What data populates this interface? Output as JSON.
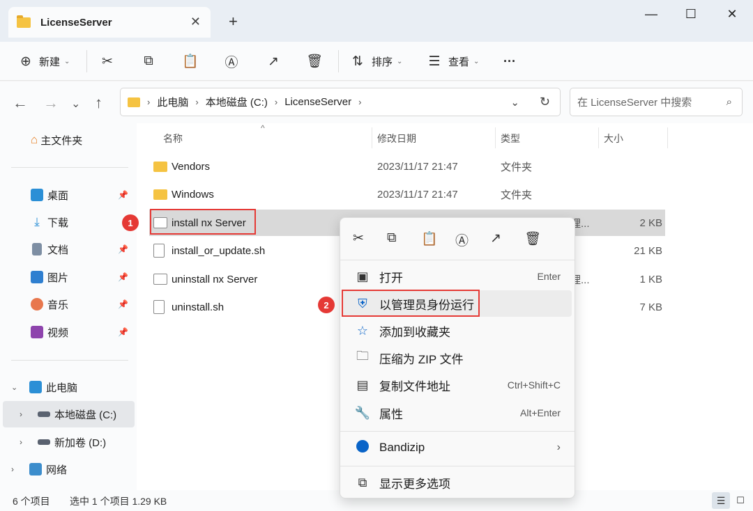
{
  "window": {
    "tab_title": "LicenseServer",
    "new_tab": "+",
    "minimize": "—",
    "maximize": "☐",
    "close": "✕"
  },
  "toolbar": {
    "new_label": "新建",
    "sort_label": "排序",
    "view_label": "查看",
    "more": "···"
  },
  "address": {
    "crumbs": [
      "此电脑",
      "本地磁盘 (C:)",
      "LicenseServer"
    ],
    "search_placeholder": "在 LicenseServer 中搜索"
  },
  "sidebar": {
    "home": "主文件夹",
    "quick": [
      {
        "label": "桌面",
        "icon": "desktop-icon"
      },
      {
        "label": "下载",
        "icon": "download-icon"
      },
      {
        "label": "文档",
        "icon": "document-icon"
      },
      {
        "label": "图片",
        "icon": "picture-icon"
      },
      {
        "label": "音乐",
        "icon": "music-icon"
      },
      {
        "label": "视频",
        "icon": "video-icon"
      }
    ],
    "this_pc": "此电脑",
    "drive_c": "本地磁盘 (C:)",
    "drive_d": "新加卷 (D:)",
    "network": "网络"
  },
  "columns": {
    "name": "名称",
    "date": "修改日期",
    "type": "类型",
    "size": "大小"
  },
  "files": [
    {
      "name": "Vendors",
      "date": "2023/11/17 21:47",
      "type": "文件夹",
      "size": ""
    },
    {
      "name": "Windows",
      "date": "2023/11/17 21:47",
      "type": "文件夹",
      "size": ""
    },
    {
      "name": "install nx Server",
      "date": "",
      "type": "理...",
      "size": "2 KB"
    },
    {
      "name": "install_or_update.sh",
      "date": "",
      "type": "",
      "size": "21 KB"
    },
    {
      "name": "uninstall nx Server",
      "date": "",
      "type": "理...",
      "size": "1 KB"
    },
    {
      "name": "uninstall.sh",
      "date": "",
      "type": "",
      "size": "7 KB"
    }
  ],
  "status": {
    "count": "6 个项目",
    "selected": "选中 1 个项目  1.29 KB"
  },
  "context_menu": {
    "open": "打开",
    "open_shortcut": "Enter",
    "run_as_admin": "以管理员身份运行",
    "add_favorites": "添加到收藏夹",
    "zip": "压缩为 ZIP 文件",
    "copy_path": "复制文件地址",
    "copy_path_shortcut": "Ctrl+Shift+C",
    "properties": "属性",
    "properties_shortcut": "Alt+Enter",
    "bandizip": "Bandizip",
    "more_options": "显示更多选项"
  },
  "badges": {
    "one": "1",
    "two": "2"
  },
  "colors": {
    "highlight": "#e53935",
    "folder": "#f5c342",
    "accent": "#0a64c8"
  }
}
